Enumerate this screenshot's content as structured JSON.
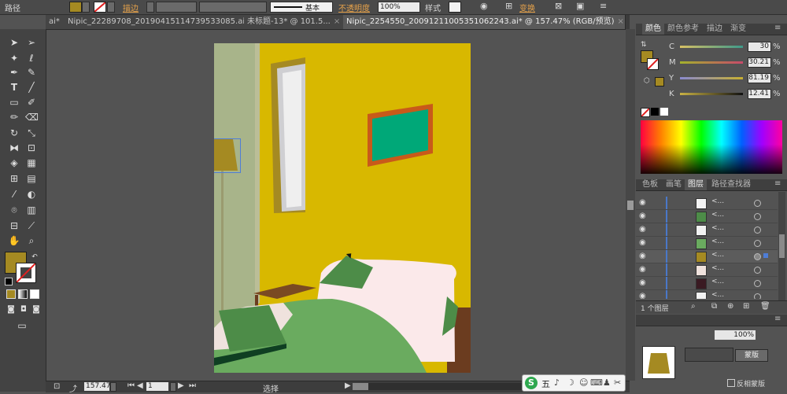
{
  "control_bar": {
    "object_type": "路径",
    "stroke_label": "描边",
    "stroke_style": "基本",
    "opacity_label": "不透明度",
    "opacity_value": "100%",
    "style_label": "样式",
    "transform_label": "变换",
    "fill_color": "#a58a22"
  },
  "tabs": [
    {
      "label": "ai*",
      "close": "×"
    },
    {
      "label": "Nipic_22289708_20190415114739533085.ai*",
      "close": "×"
    },
    {
      "label": "未标题-13* @ 101.5...",
      "close": "×"
    },
    {
      "label": "Nipic_2254550_20091211005351062243.ai* @ 157.47% (RGB/预览)",
      "close": "×"
    }
  ],
  "statusbar": {
    "zoom": "157.47",
    "page": "1",
    "mode": "选择"
  },
  "color_panel": {
    "tabs": [
      "颜色",
      "颜色参考",
      "描边",
      "渐变"
    ],
    "channels": [
      {
        "name": "C",
        "value": "30",
        "unit": "%"
      },
      {
        "name": "M",
        "value": "30.21",
        "unit": "%"
      },
      {
        "name": "Y",
        "value": "81.19",
        "unit": "%"
      },
      {
        "name": "K",
        "value": "12.41",
        "unit": "%"
      }
    ]
  },
  "layers_panel": {
    "tabs": [
      "色板",
      "画笔",
      "图层",
      "路径查找器"
    ],
    "rows": [
      {
        "name": "<..."
      },
      {
        "name": "<..."
      },
      {
        "name": "<..."
      },
      {
        "name": "<..."
      },
      {
        "name": "<..."
      },
      {
        "name": "<..."
      },
      {
        "name": "<..."
      },
      {
        "name": "<..."
      }
    ],
    "count_label": "1 个图层"
  },
  "transparency_panel": {
    "opacity_value": "100%",
    "make_mask_label": "蒙版",
    "invert_mask_label": "反相蒙版"
  },
  "ime": {
    "label": "五"
  }
}
